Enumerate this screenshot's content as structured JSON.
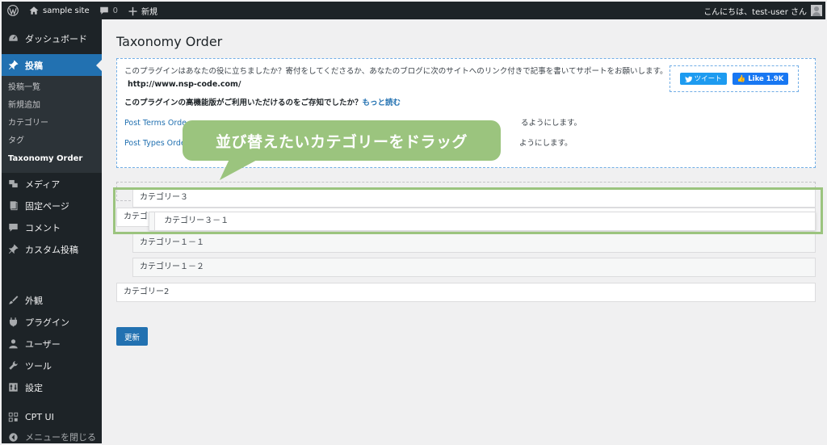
{
  "adminbar": {
    "site_name": "sample site",
    "comments_count": "0",
    "new_label": "新規",
    "greeting": "こんにちは、test-user さん"
  },
  "sidebar": {
    "items": [
      {
        "label": "ダッシュボード",
        "icon": "dashboard-icon"
      },
      {
        "label": "投稿",
        "icon": "pin-icon"
      },
      {
        "label": "メディア",
        "icon": "media-icon"
      },
      {
        "label": "固定ページ",
        "icon": "page-icon"
      },
      {
        "label": "コメント",
        "icon": "comment-icon"
      },
      {
        "label": "カスタム投稿",
        "icon": "pin-icon"
      },
      {
        "label": "外観",
        "icon": "brush-icon"
      },
      {
        "label": "プラグイン",
        "icon": "plugin-icon"
      },
      {
        "label": "ユーザー",
        "icon": "user-icon"
      },
      {
        "label": "ツール",
        "icon": "wrench-icon"
      },
      {
        "label": "設定",
        "icon": "settings-icon"
      },
      {
        "label": "CPT UI",
        "icon": "grid-icon"
      },
      {
        "label": "メニューを閉じる",
        "icon": "collapse-icon"
      }
    ],
    "submenu": [
      "投稿一覧",
      "新規追加",
      "カテゴリー",
      "タグ",
      "Taxonomy Order"
    ]
  },
  "main": {
    "title": "Taxonomy Order",
    "info_text": "このプラグインはあなたの役に立ちましたか？寄付をしてくださるか、あなたのブログに次のサイトへのリンク付きで記事を書いてサポートをお願いします。",
    "info_url": "http://www.nsp-code.com/",
    "pro_text": "このプラグインの高機能版がご利用いただけるのをご存知でしたか？",
    "pro_link": "もっと読む",
    "terms_left": "Post Terms Orde",
    "terms_right": "るようにします。",
    "types_left": "Post Types Orde",
    "types_right": "ようにします。",
    "tweet_label": "ツイート",
    "like_label": "Like 1.9K",
    "tooltip": "並び替えたいカテゴリーをドラッグ",
    "categories": {
      "cat3": "カテゴリー３",
      "cat_partial": "カテゴリ",
      "cat3_1": "カテゴリー３－１",
      "cat1_1": "カテゴリー１－１",
      "cat1_2": "カテゴリー１－２",
      "cat2": "カテゴリー2"
    },
    "update_label": "更新"
  },
  "colors": {
    "admin_dark": "#1d2327",
    "accent_blue": "#2271b1",
    "highlight_green": "#9bc47e"
  }
}
